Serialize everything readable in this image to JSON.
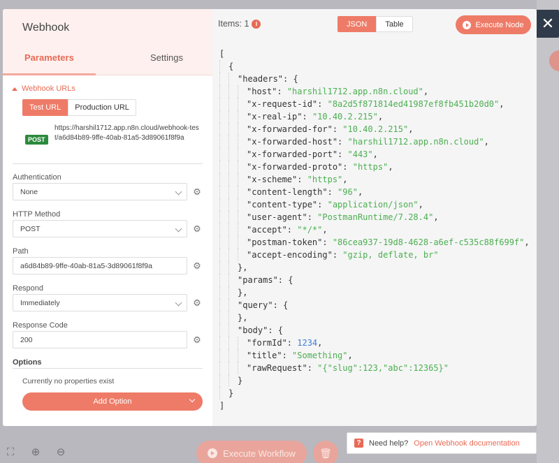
{
  "node": {
    "title": "Webhook",
    "tabs": {
      "parameters": "Parameters",
      "settings": "Settings"
    }
  },
  "webhook_urls": {
    "section_label": "Webhook URLs",
    "test_tab": "Test URL",
    "production_tab": "Production URL",
    "method_badge": "POST",
    "url": "https://harshil1712.app.n8n.cloud/webhook-test/a6d84b89-9ffe-40ab-81a5-3d89061f8f9a"
  },
  "params": {
    "authentication": {
      "label": "Authentication",
      "value": "None"
    },
    "http_method": {
      "label": "HTTP Method",
      "value": "POST"
    },
    "path": {
      "label": "Path",
      "value": "a6d84b89-9ffe-40ab-81a5-3d89061f8f9a"
    },
    "respond": {
      "label": "Respond",
      "value": "Immediately"
    },
    "response_code": {
      "label": "Response Code",
      "value": "200"
    }
  },
  "options": {
    "label": "Options",
    "empty_text": "Currently no properties exist",
    "add_label": "Add Option"
  },
  "output": {
    "items_label": "Items: 1",
    "json_btn": "JSON",
    "table_btn": "Table",
    "execute_node": "Execute Node"
  },
  "json_lines": [
    {
      "indent": 0,
      "parts": [
        [
          "p",
          "["
        ]
      ]
    },
    {
      "indent": 1,
      "parts": [
        [
          "p",
          "{"
        ]
      ]
    },
    {
      "indent": 2,
      "parts": [
        [
          "k",
          "\"headers\""
        ],
        [
          "p",
          ": {"
        ]
      ]
    },
    {
      "indent": 3,
      "parts": [
        [
          "k",
          "\"host\""
        ],
        [
          "p",
          ": "
        ],
        [
          "s",
          "\"harshil1712.app.n8n.cloud\""
        ],
        [
          "p",
          ","
        ]
      ]
    },
    {
      "indent": 3,
      "parts": [
        [
          "k",
          "\"x-request-id\""
        ],
        [
          "p",
          ": "
        ],
        [
          "s",
          "\"8a2d5f871814ed41987ef8fb451b20d0\""
        ],
        [
          "p",
          ","
        ]
      ]
    },
    {
      "indent": 3,
      "parts": [
        [
          "k",
          "\"x-real-ip\""
        ],
        [
          "p",
          ": "
        ],
        [
          "s",
          "\"10.40.2.215\""
        ],
        [
          "p",
          ","
        ]
      ]
    },
    {
      "indent": 3,
      "parts": [
        [
          "k",
          "\"x-forwarded-for\""
        ],
        [
          "p",
          ": "
        ],
        [
          "s",
          "\"10.40.2.215\""
        ],
        [
          "p",
          ","
        ]
      ]
    },
    {
      "indent": 3,
      "parts": [
        [
          "k",
          "\"x-forwarded-host\""
        ],
        [
          "p",
          ": "
        ],
        [
          "s",
          "\"harshil1712.app.n8n.cloud\""
        ],
        [
          "p",
          ","
        ]
      ]
    },
    {
      "indent": 3,
      "parts": [
        [
          "k",
          "\"x-forwarded-port\""
        ],
        [
          "p",
          ": "
        ],
        [
          "s",
          "\"443\""
        ],
        [
          "p",
          ","
        ]
      ]
    },
    {
      "indent": 3,
      "parts": [
        [
          "k",
          "\"x-forwarded-proto\""
        ],
        [
          "p",
          ": "
        ],
        [
          "s",
          "\"https\""
        ],
        [
          "p",
          ","
        ]
      ]
    },
    {
      "indent": 3,
      "parts": [
        [
          "k",
          "\"x-scheme\""
        ],
        [
          "p",
          ": "
        ],
        [
          "s",
          "\"https\""
        ],
        [
          "p",
          ","
        ]
      ]
    },
    {
      "indent": 3,
      "parts": [
        [
          "k",
          "\"content-length\""
        ],
        [
          "p",
          ": "
        ],
        [
          "s",
          "\"96\""
        ],
        [
          "p",
          ","
        ]
      ]
    },
    {
      "indent": 3,
      "parts": [
        [
          "k",
          "\"content-type\""
        ],
        [
          "p",
          ": "
        ],
        [
          "s",
          "\"application/json\""
        ],
        [
          "p",
          ","
        ]
      ]
    },
    {
      "indent": 3,
      "parts": [
        [
          "k",
          "\"user-agent\""
        ],
        [
          "p",
          ": "
        ],
        [
          "s",
          "\"PostmanRuntime/7.28.4\""
        ],
        [
          "p",
          ","
        ]
      ]
    },
    {
      "indent": 3,
      "parts": [
        [
          "k",
          "\"accept\""
        ],
        [
          "p",
          ": "
        ],
        [
          "s",
          "\"*/*\""
        ],
        [
          "p",
          ","
        ]
      ]
    },
    {
      "indent": 3,
      "parts": [
        [
          "k",
          "\"postman-token\""
        ],
        [
          "p",
          ": "
        ],
        [
          "s",
          "\"86cea937-19d8-4628-a6ef-c535c88f699f\""
        ],
        [
          "p",
          ","
        ]
      ]
    },
    {
      "indent": 3,
      "parts": [
        [
          "k",
          "\"accept-encoding\""
        ],
        [
          "p",
          ": "
        ],
        [
          "s",
          "\"gzip, deflate, br\""
        ]
      ]
    },
    {
      "indent": 2,
      "parts": [
        [
          "p",
          "},"
        ]
      ]
    },
    {
      "indent": 2,
      "parts": [
        [
          "k",
          "\"params\""
        ],
        [
          "p",
          ": {"
        ]
      ]
    },
    {
      "indent": 2,
      "parts": [
        [
          "p",
          "},"
        ]
      ]
    },
    {
      "indent": 2,
      "parts": [
        [
          "k",
          "\"query\""
        ],
        [
          "p",
          ": {"
        ]
      ]
    },
    {
      "indent": 2,
      "parts": [
        [
          "p",
          "},"
        ]
      ]
    },
    {
      "indent": 2,
      "parts": [
        [
          "k",
          "\"body\""
        ],
        [
          "p",
          ": {"
        ]
      ]
    },
    {
      "indent": 3,
      "parts": [
        [
          "k",
          "\"formId\""
        ],
        [
          "p",
          ": "
        ],
        [
          "n",
          "1234"
        ],
        [
          "p",
          ","
        ]
      ]
    },
    {
      "indent": 3,
      "parts": [
        [
          "k",
          "\"title\""
        ],
        [
          "p",
          ": "
        ],
        [
          "s",
          "\"Something\""
        ],
        [
          "p",
          ","
        ]
      ]
    },
    {
      "indent": 3,
      "parts": [
        [
          "k",
          "\"rawRequest\""
        ],
        [
          "p",
          ": "
        ],
        [
          "s",
          "\"{\"slug\":123,\"abc\":12365}\""
        ]
      ]
    },
    {
      "indent": 2,
      "parts": [
        [
          "p",
          "}"
        ]
      ]
    },
    {
      "indent": 1,
      "parts": [
        [
          "p",
          "}"
        ]
      ]
    },
    {
      "indent": 0,
      "parts": [
        [
          "p",
          "]"
        ]
      ]
    }
  ],
  "canvas": {
    "execute_workflow": "Execute Workflow",
    "help_text": "Need help?",
    "help_link": "Open Webhook documentation"
  },
  "icons": {
    "close": "close-icon",
    "gear": "gear-icon",
    "info": "info-icon",
    "play": "play-icon",
    "trash": "trash-icon",
    "zoom_in": "zoom-in-icon",
    "zoom_out": "zoom-out-icon",
    "fit": "fit-view-icon"
  },
  "colors": {
    "accent": "#ee7b67",
    "post_badge": "#2c8a3e",
    "json_string": "#4caf50",
    "json_number": "#3c7dd6"
  }
}
